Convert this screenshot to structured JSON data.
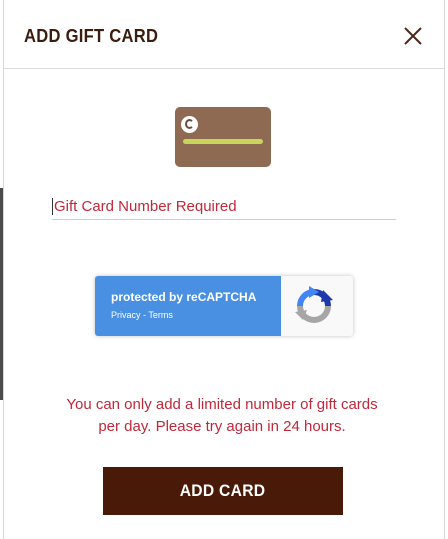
{
  "modal": {
    "title": "ADD GIFT CARD",
    "close_icon": "close-icon"
  },
  "card_image": {
    "icon": "gift-card-icon",
    "color": "#8e6a52",
    "stripe_color": "#c8d55a"
  },
  "gift_card_input": {
    "placeholder": "Gift Card Number Required",
    "value": ""
  },
  "recaptcha": {
    "title": "protected by reCAPTCHA",
    "privacy": "Privacy",
    "separator": " - ",
    "terms": "Terms",
    "icon": "recaptcha-logo-icon"
  },
  "message": {
    "text": "You can only add a limited number of gift cards per day. Please try again in 24 hours.",
    "color": "#c0283a"
  },
  "submit": {
    "label": "ADD CARD",
    "color": "#4a1a08"
  }
}
